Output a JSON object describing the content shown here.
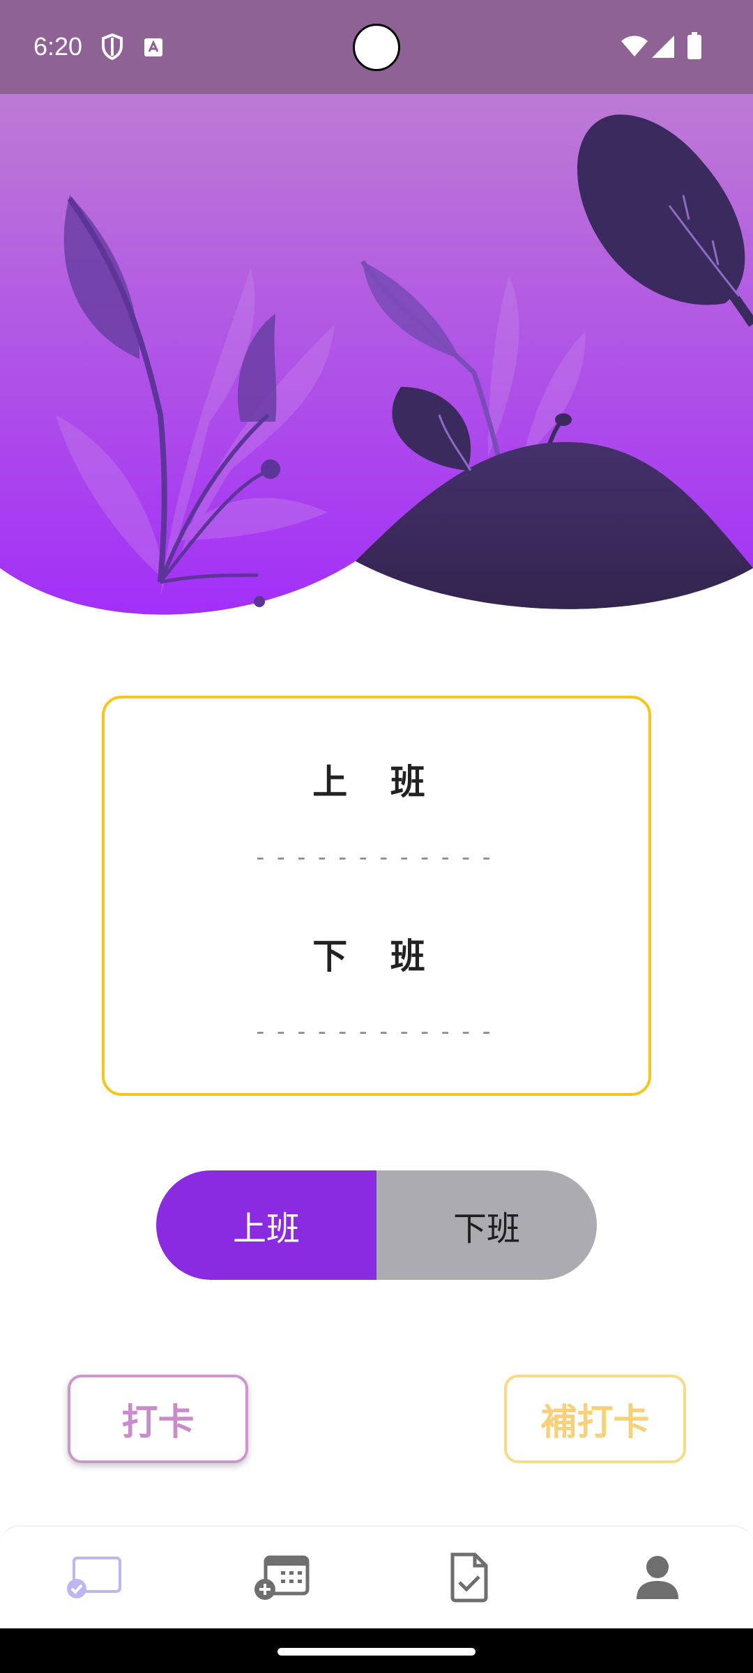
{
  "status_bar": {
    "time": "6:20",
    "left_icons": [
      "shield-icon",
      "keyboard-a-icon"
    ],
    "right_icons": [
      "wifi-icon",
      "signal-icon",
      "battery-icon"
    ]
  },
  "card": {
    "clock_in_label": "上 班",
    "clock_in_time": "------------",
    "clock_out_label": "下 班",
    "clock_out_time": "------------"
  },
  "toggle": {
    "options": [
      "上班",
      "下班"
    ],
    "selected": "上班",
    "active_color": "#8a2be2",
    "inactive_color": "#acabb0"
  },
  "actions": {
    "punch_label": "打卡",
    "makeup_punch_label": "補打卡",
    "punch_color": "#c98bc9",
    "makeup_color": "#f7d17a"
  },
  "bottom_nav": {
    "items": [
      "punch-in-icon",
      "add-calendar-icon",
      "document-check-icon",
      "person-icon"
    ],
    "selected_index": 0
  },
  "colors": {
    "hero_top": "#bd7ad4",
    "hero_bottom": "#a32ff8",
    "dark_plant": "#3b2a5e",
    "card_border": "#f5c518"
  }
}
